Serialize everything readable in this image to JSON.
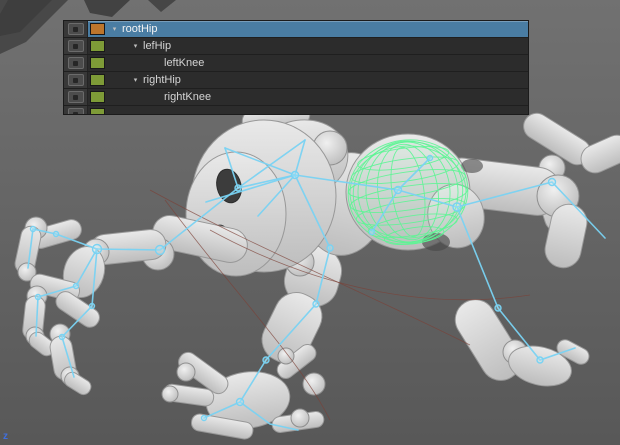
{
  "outliner": {
    "selection_color": "#4a7da3",
    "arrow_glyph": "▾",
    "rows": [
      {
        "label": "rootHip",
        "selected": true,
        "swatch": "#bd762d",
        "indent": 0,
        "has_arrow": true
      },
      {
        "label": "lefHip",
        "selected": false,
        "swatch": "#7e9b37",
        "indent": 1,
        "has_arrow": true
      },
      {
        "label": "leftKnee",
        "selected": false,
        "swatch": "#7e9b37",
        "indent": 2,
        "has_arrow": false
      },
      {
        "label": "rightHip",
        "selected": false,
        "swatch": "#7e9b37",
        "indent": 1,
        "has_arrow": true
      },
      {
        "label": "rightKnee",
        "selected": false,
        "swatch": "#7e9b37",
        "indent": 2,
        "has_arrow": false
      },
      {
        "label": "",
        "selected": false,
        "swatch": "#7e9b37",
        "indent": 0,
        "has_arrow": false
      }
    ]
  },
  "viewport": {
    "axis_label": "z",
    "skeleton_color": "#79d2f2",
    "selection_wireframe_color": "#5cf593",
    "background_top": "#717171",
    "background_bottom": "#585858"
  }
}
